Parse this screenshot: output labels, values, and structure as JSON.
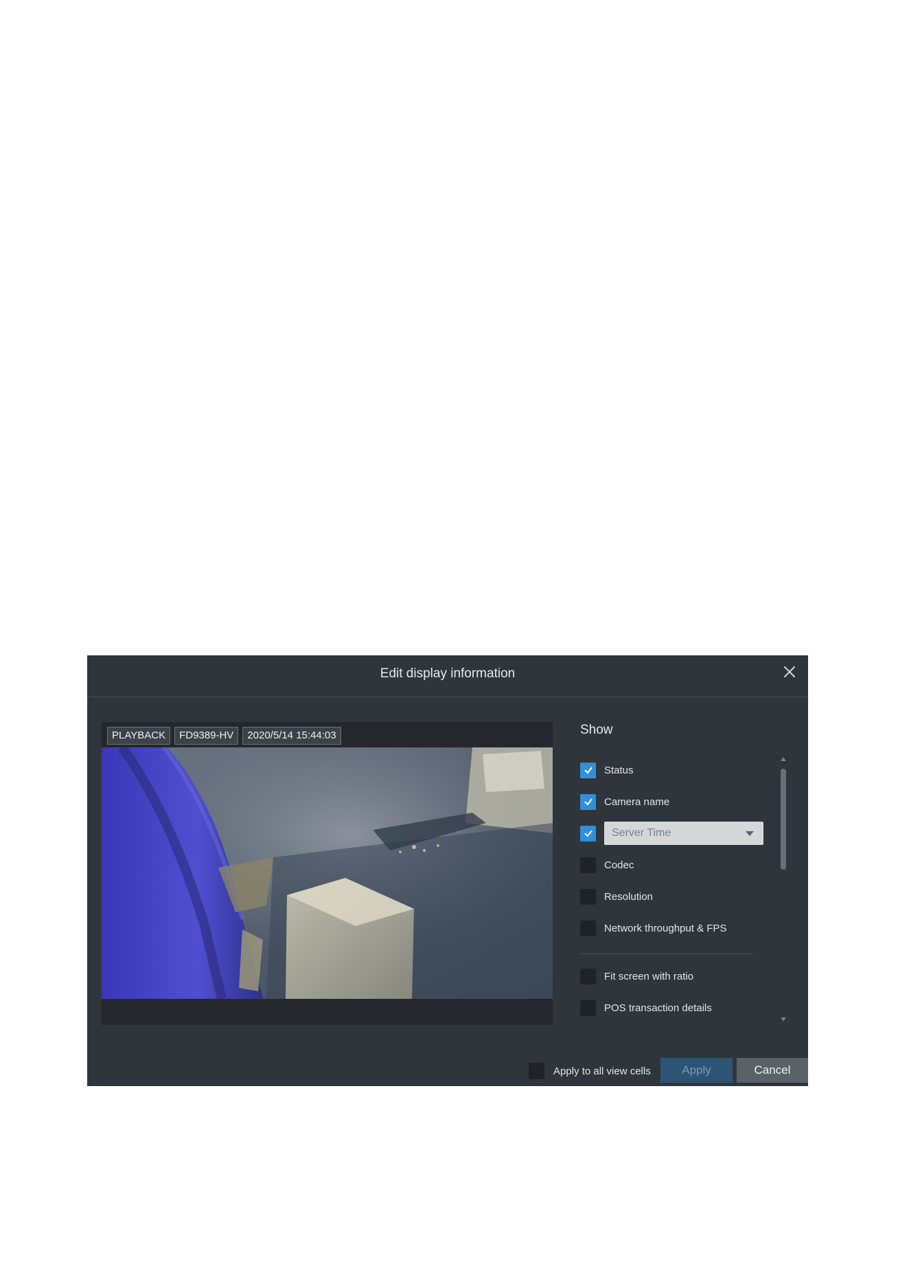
{
  "dialog": {
    "title": "Edit display information",
    "close_icon": "close-icon"
  },
  "preview": {
    "tags": [
      "PLAYBACK",
      "FD9389-HV",
      "2020/5/14 15:44:03"
    ]
  },
  "show": {
    "title": "Show",
    "options": [
      {
        "label": "Status",
        "checked": true
      },
      {
        "label": "Camera name",
        "checked": true
      },
      {
        "label": "",
        "checked": true,
        "select_value": "Server Time"
      },
      {
        "label": "Codec",
        "checked": false
      },
      {
        "label": "Resolution",
        "checked": false
      },
      {
        "label": "Network throughput & FPS",
        "checked": false
      },
      {
        "label": "Fit screen with ratio",
        "checked": false
      },
      {
        "label": "POS transaction details",
        "checked": false
      }
    ]
  },
  "footer": {
    "apply_all_label": "Apply to all view cells",
    "apply_all_checked": false,
    "apply_label": "Apply",
    "cancel_label": "Cancel"
  },
  "colors": {
    "dialog_bg": "#30353b",
    "checkbox_checked": "#2f8fd8",
    "apply_button": "#2b5475",
    "cancel_button": "#5b6167"
  }
}
